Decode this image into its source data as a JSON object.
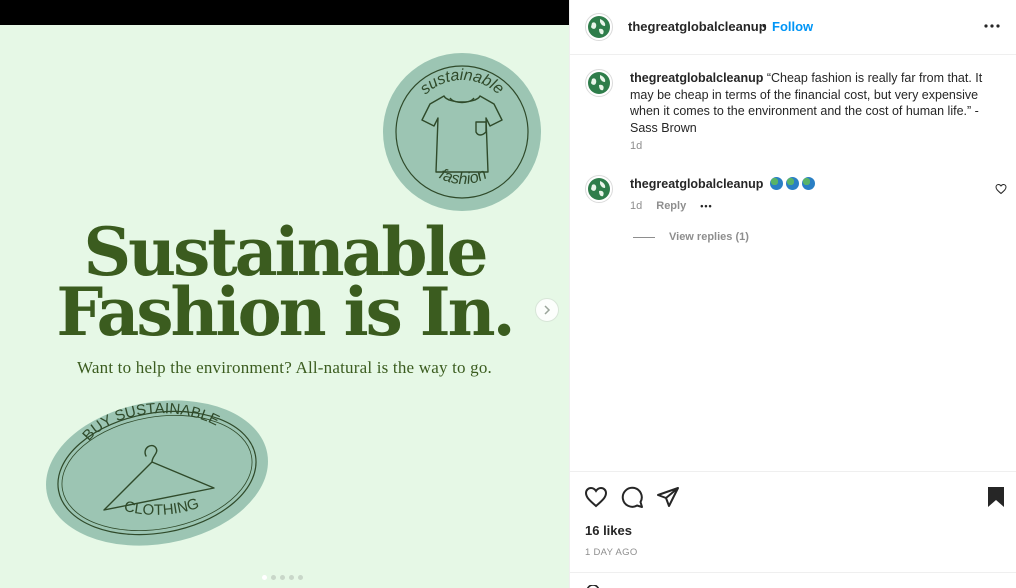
{
  "media": {
    "hero_title_line1": "Sustainable",
    "hero_title_line2": "Fashion is In.",
    "hero_subtitle": "Want to help the environment? All-natural is the way to go.",
    "sticker_top_text_top": "sustainable",
    "sticker_top_text_bottom": "fashion",
    "sticker_bottom_text_top": "BUY SUSTAINABLE",
    "sticker_bottom_text_bottom": "CLOTHING",
    "carousel": {
      "total": 5,
      "active": 1
    },
    "colors": {
      "background": "#e6f8e6",
      "text": "#3b5c1f",
      "sticker": "#9cc5b3",
      "sticker_ink": "#2f4a2a"
    }
  },
  "header": {
    "username": "thegreatglobalcleanup",
    "separator": "•",
    "follow_label": "Follow"
  },
  "caption": {
    "username": "thegreatglobalcleanup",
    "text": "“Cheap fashion is really far from that. It may be cheap in terms of the financial cost, but very expensive when it comes to the environment and the cost of human life.” - Sass Brown",
    "time": "1d"
  },
  "comments": [
    {
      "username": "thegreatglobalcleanup",
      "emoji_count": 3,
      "emoji_name": "earth-globe",
      "time": "1d",
      "reply_label": "Reply",
      "more_label": "•••",
      "view_replies_label": "View replies (1)"
    }
  ],
  "actions": {
    "likes": "16 likes",
    "posted": "1 DAY AGO"
  },
  "colors": {
    "accent": "#0095f6",
    "muted": "#8e8e8e",
    "text": "#262626"
  }
}
